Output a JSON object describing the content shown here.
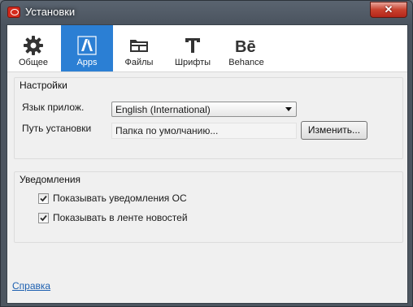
{
  "window": {
    "title": "Установки",
    "close_label": "✕"
  },
  "tabs": [
    {
      "label": "Общее",
      "icon": "gear-icon",
      "active": false
    },
    {
      "label": "Apps",
      "icon": "adobe-apps-icon",
      "active": true
    },
    {
      "label": "Файлы",
      "icon": "folder-icon",
      "active": false
    },
    {
      "label": "Шрифты",
      "icon": "font-icon",
      "active": false
    },
    {
      "label": "Behance",
      "icon": "behance-icon",
      "active": false
    }
  ],
  "settings": {
    "title": "Настройки",
    "language_label": "Язык прилож.",
    "language_value": "English (International)",
    "install_path_label": "Путь установки",
    "install_path_value": "Папка по умолчанию...",
    "change_button": "Изменить..."
  },
  "notifications": {
    "title": "Уведомления",
    "items": [
      {
        "label": "Показывать уведомления ОС",
        "checked": true
      },
      {
        "label": "Показывать в ленте новостей",
        "checked": true
      }
    ]
  },
  "footer": {
    "help_link": "Справка"
  },
  "colors": {
    "accent": "#2b7fd4",
    "link": "#1c5fb0",
    "close": "#c8412e"
  }
}
